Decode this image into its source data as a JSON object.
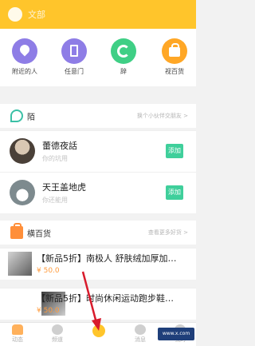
{
  "header": {
    "title": "文部"
  },
  "quick_nav": [
    {
      "label": "附近的人",
      "icon": "location-pin-icon",
      "color": "#8e7de6"
    },
    {
      "label": "任意门",
      "icon": "door-icon",
      "color": "#8e7de6"
    },
    {
      "label": "辞",
      "icon": "refresh-circle-icon",
      "color": "#3fcf85"
    },
    {
      "label": "视百货",
      "icon": "shopping-bag-icon",
      "color": "#ffa726"
    }
  ],
  "friends_section": {
    "title": "陌",
    "more": "换个小伙伴交朋友 >"
  },
  "friends": [
    {
      "name": "蕾德夜話",
      "sub": "你的坑用",
      "button": "添加"
    },
    {
      "name": "天王盖地虎",
      "sub": "你还能用",
      "button": "添加"
    }
  ],
  "shop_section": {
    "title": "横百货",
    "more": "查看更多好货 >"
  },
  "products": [
    {
      "title": "【新品5折】南极人 舒肤绒加厚加…",
      "price": "¥ 50.0"
    },
    {
      "title": "【新品5折】时尚休闲运动跑步鞋…",
      "price": "¥ 50.0"
    }
  ],
  "tabs": [
    {
      "label": "动态",
      "icon": "home-icon"
    },
    {
      "label": "频道",
      "icon": "channel-icon"
    },
    {
      "label": "",
      "icon": "center-tab-icon"
    },
    {
      "label": "消息",
      "icon": "message-icon"
    },
    {
      "label": "我的",
      "icon": "profile-icon"
    }
  ],
  "watermark": "www.x.com",
  "colors": {
    "brand": "#ffc52b",
    "accent_green": "#3fcf9b",
    "price": "#ff9b3d",
    "annotation_arrow": "#d81b2c"
  }
}
